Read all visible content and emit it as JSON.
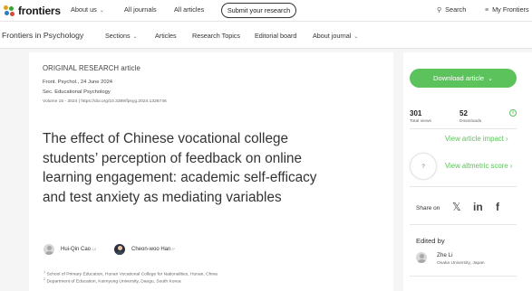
{
  "topbar": {
    "logo": "frontiers",
    "about_us": "About us",
    "all_journals": "All journals",
    "all_articles": "All articles",
    "submit": "Submit your research",
    "search": "Search",
    "my_frontiers": "My Frontiers"
  },
  "journal_nav": {
    "name": "Frontiers in Psychology",
    "items": [
      "Sections",
      "Articles",
      "Research Topics",
      "Editorial board",
      "About journal"
    ]
  },
  "article": {
    "type": "ORIGINAL RESEARCH article",
    "citation": "Front. Psychol., 24 June 2024",
    "section": "Sec. Educational Psychology",
    "volume_doi": "Volume 15 - 2024 | https://doi.org/10.3389/fpsyg.2024.1326746",
    "title": "The effect of Chinese vocational college students’ perception of feedback on online learning engagement: academic self-efficacy and test anxiety as mediating variables",
    "authors": [
      {
        "name": "Hui-Qin Cao",
        "sup": "1,2"
      },
      {
        "name": "Cheon-woo Han",
        "sup": "2*"
      }
    ],
    "affiliations": [
      "School of Primary Education, Hunan Vocational College for Nationalities, Hunan, China",
      "Department of Education, Keimyung University, Daegu, South Korea"
    ],
    "affiliation_numbers": [
      "1",
      "2"
    ]
  },
  "sidebar": {
    "download": "Download article",
    "views_count": "301",
    "views_label": "Total views",
    "downloads_count": "52",
    "downloads_label": "Downloads",
    "impact_link": "View article impact",
    "altmetric_badge": "?",
    "altmetric_link": "View altmetric score",
    "share_on": "Share on",
    "edited_by": "Edited by",
    "editor_name": "Zhe Li",
    "editor_affiliation": "Osaka University, Japan"
  },
  "colors": {
    "accent_green": "#5cc25c",
    "background": "#f5f5f5"
  },
  "icons": {
    "search": "search-icon",
    "menu": "menu-icon",
    "chevron": "chevron-down-icon",
    "info": "info-icon",
    "x": "x-logo-icon",
    "linkedin": "linkedin-icon",
    "facebook": "facebook-icon"
  }
}
